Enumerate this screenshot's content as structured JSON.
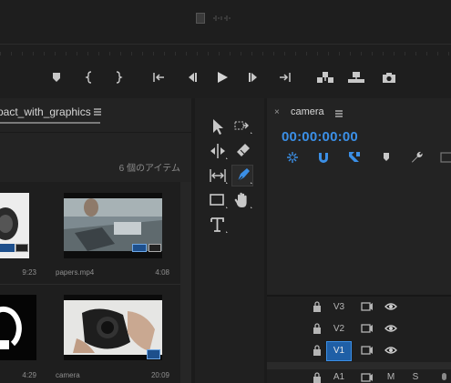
{
  "monitor": {
    "transport_buttons": [
      "add-marker",
      "mark-in",
      "mark-out",
      "go-to-in",
      "step-back",
      "play",
      "step-forward",
      "go-to-out",
      "insert",
      "overwrite",
      "export-frame"
    ]
  },
  "project": {
    "tab_label": "pact_with_graphics",
    "item_count": "6 個のアイテム",
    "items": [
      {
        "name": "",
        "duration": "9:23"
      },
      {
        "name": "papers.mp4",
        "duration": "4:08"
      },
      {
        "name": "",
        "duration": "4:29"
      },
      {
        "name": "camera",
        "duration": "20:09"
      }
    ]
  },
  "tools": [
    "selection",
    "track-select-forward",
    "ripple-edit",
    "razor",
    "slip",
    "pen",
    "rectangle",
    "hand",
    "type"
  ],
  "timeline": {
    "sequence_name": "camera",
    "close_glyph": "×",
    "timecode": "00:00:00:00",
    "tracks": [
      {
        "id": "V3",
        "label": "V3"
      },
      {
        "id": "V2",
        "label": "V2"
      },
      {
        "id": "V1",
        "label": "V1",
        "targeted": true
      },
      {
        "id": "A1",
        "label": "A1",
        "mute": "M",
        "solo": "S"
      }
    ]
  },
  "colors": {
    "accent": "#3b8fe6",
    "target": "#1f5fa6",
    "bg": "#1b1b1b",
    "panel": "#232323"
  }
}
